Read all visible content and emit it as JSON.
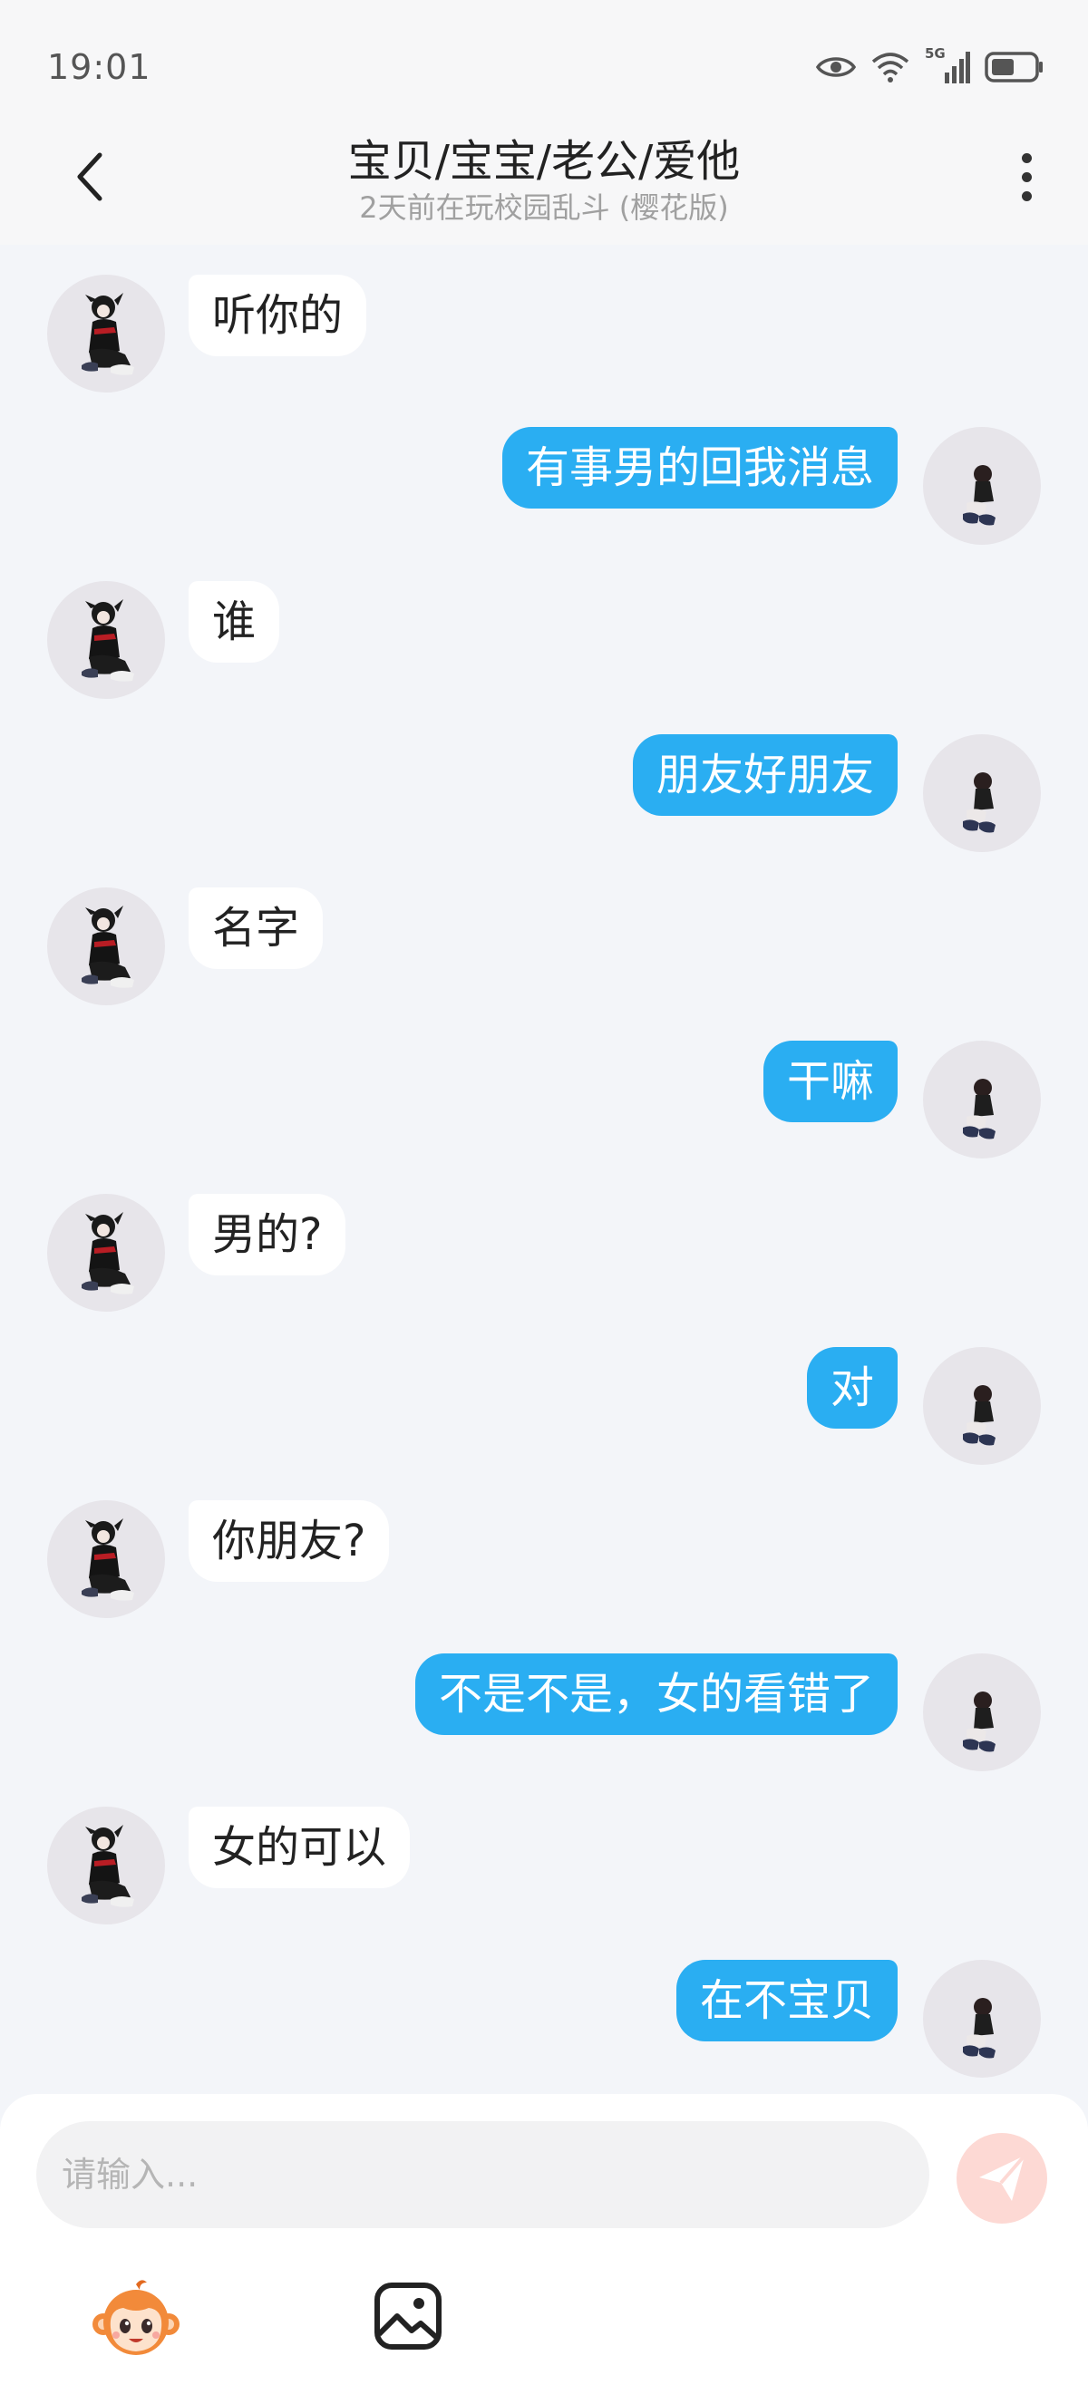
{
  "status_bar": {
    "time": "19:01",
    "network": "5G"
  },
  "header": {
    "title": "宝贝/宝宝/老公/爱他",
    "subtitle": "2天前在玩校园乱斗 (樱花版)"
  },
  "messages": [
    {
      "side": "in",
      "text": "听你的"
    },
    {
      "side": "out",
      "text": "有事男的回我消息"
    },
    {
      "side": "in",
      "text": "谁"
    },
    {
      "side": "out",
      "text": "朋友好朋友"
    },
    {
      "side": "in",
      "text": "名字"
    },
    {
      "side": "out",
      "text": "干嘛"
    },
    {
      "side": "in",
      "text": "男的?"
    },
    {
      "side": "out",
      "text": "对"
    },
    {
      "side": "in",
      "text": "你朋友?"
    },
    {
      "side": "out",
      "text": "不是不是，女的看错了"
    },
    {
      "side": "in",
      "text": "女的可以"
    },
    {
      "side": "out",
      "text": "在不宝贝"
    }
  ],
  "composer": {
    "placeholder": "请输入..."
  },
  "icons": {
    "back": "chevron-left-icon",
    "more": "more-vertical-icon",
    "send": "paper-plane-icon",
    "emoji": "monkey-emoji-icon",
    "image": "image-icon"
  },
  "colors": {
    "accent": "#2aaef2",
    "send_inactive": "#fdd9d4",
    "background": "#f3f5f9"
  }
}
